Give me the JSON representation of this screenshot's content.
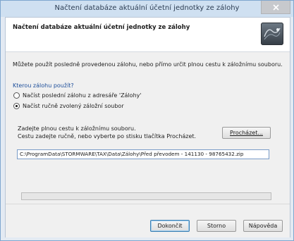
{
  "window": {
    "title": "Načtení databáze aktuální účetní jednotky ze zálohy"
  },
  "header": {
    "title": "Načtení databáze aktuální účetní jednotky ze zálohy"
  },
  "content": {
    "intro": "Můžete použít posledně provedenou zálohu, nebo přímo určit plnou cestu k záložnímu souboru.",
    "question": "Kterou zálohu použít?",
    "options": [
      {
        "label": "Načíst poslední zálohu z adresáře 'Zálohy'",
        "selected": false
      },
      {
        "label": "Načíst ručně zvolený záložní soubor",
        "selected": true
      }
    ],
    "path_heading": "Zadejte plnou cestu k záložnímu souboru.",
    "path_hint": "Cestu zadejte ručně, nebo vyberte po stisku tlačítka Procházet.",
    "browse_label": "Procházet...",
    "path_value": "C:\\ProgramData\\STORMWARE\\TAX\\Data\\Zálohy\\Před převodem - 141130 - 98765432.zip",
    "progress_fraction": 0
  },
  "footer": {
    "finish_label": "Dokončit",
    "cancel_label": "Storno",
    "help_label": "Nápověda"
  },
  "colors": {
    "title_bar": "#cfe0f1",
    "accent": "#3c7fb1"
  },
  "icons": [
    "close-icon",
    "wizard-icon"
  ]
}
